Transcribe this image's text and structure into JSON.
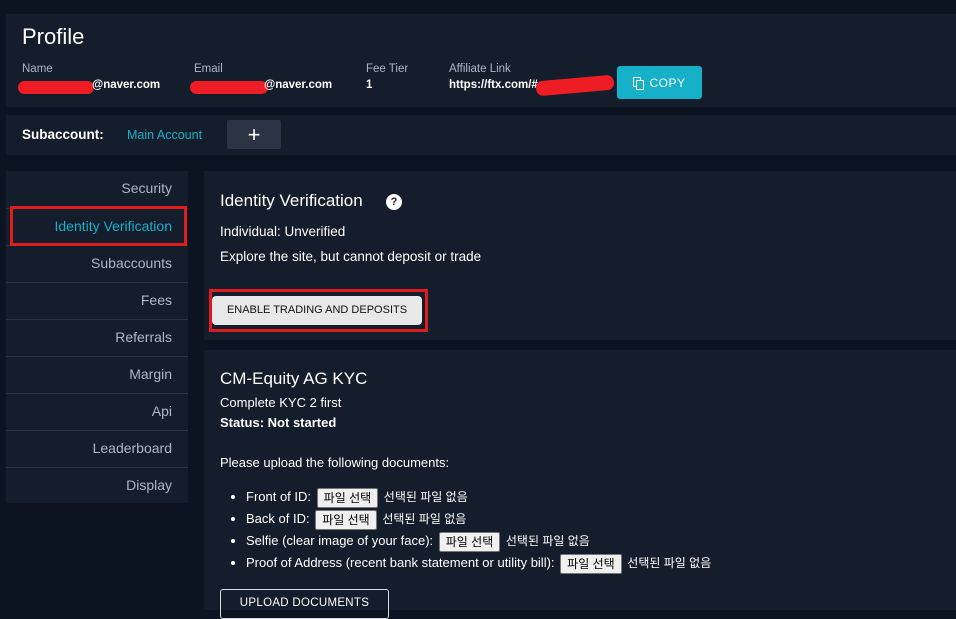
{
  "profile": {
    "title": "Profile",
    "name_label": "Name",
    "name_value": "@naver.com",
    "email_label": "Email",
    "email_value": "@naver.com",
    "fee_tier_label": "Fee Tier",
    "fee_tier_value": "1",
    "affiliate_label": "Affiliate Link",
    "affiliate_value": "https://ftx.com/#a",
    "copy_label": "COPY"
  },
  "subaccount": {
    "label": "Subaccount:",
    "main": "Main Account",
    "add": "+"
  },
  "sidebar": {
    "items": [
      {
        "label": "Security"
      },
      {
        "label": "Identity Verification"
      },
      {
        "label": "Subaccounts"
      },
      {
        "label": "Fees"
      },
      {
        "label": "Referrals"
      },
      {
        "label": "Margin"
      },
      {
        "label": "Api"
      },
      {
        "label": "Leaderboard"
      },
      {
        "label": "Display"
      }
    ]
  },
  "identity": {
    "title": "Identity Verification",
    "help": "?",
    "status": "Individual: Unverified",
    "description": "Explore the site, but cannot deposit or trade",
    "enable_button": "ENABLE TRADING AND DEPOSITS"
  },
  "kyc": {
    "title": "CM-Equity AG KYC",
    "subtitle": "Complete KYC 2 first",
    "status": "Status: Not started",
    "instructions": "Please upload the following documents:",
    "file_button": "파일 선택",
    "no_file": "선택된 파일 없음",
    "documents": [
      {
        "label": "Front of ID:"
      },
      {
        "label": "Back of ID:"
      },
      {
        "label": "Selfie (clear image of your face):"
      },
      {
        "label": "Proof of Address (recent bank statement or utility bill):"
      }
    ],
    "upload_button": "UPLOAD DOCUMENTS"
  },
  "colors": {
    "accent": "#16b0c8",
    "highlight": "#e01b1b",
    "background": "#0c1421",
    "panel": "#141d2b"
  }
}
